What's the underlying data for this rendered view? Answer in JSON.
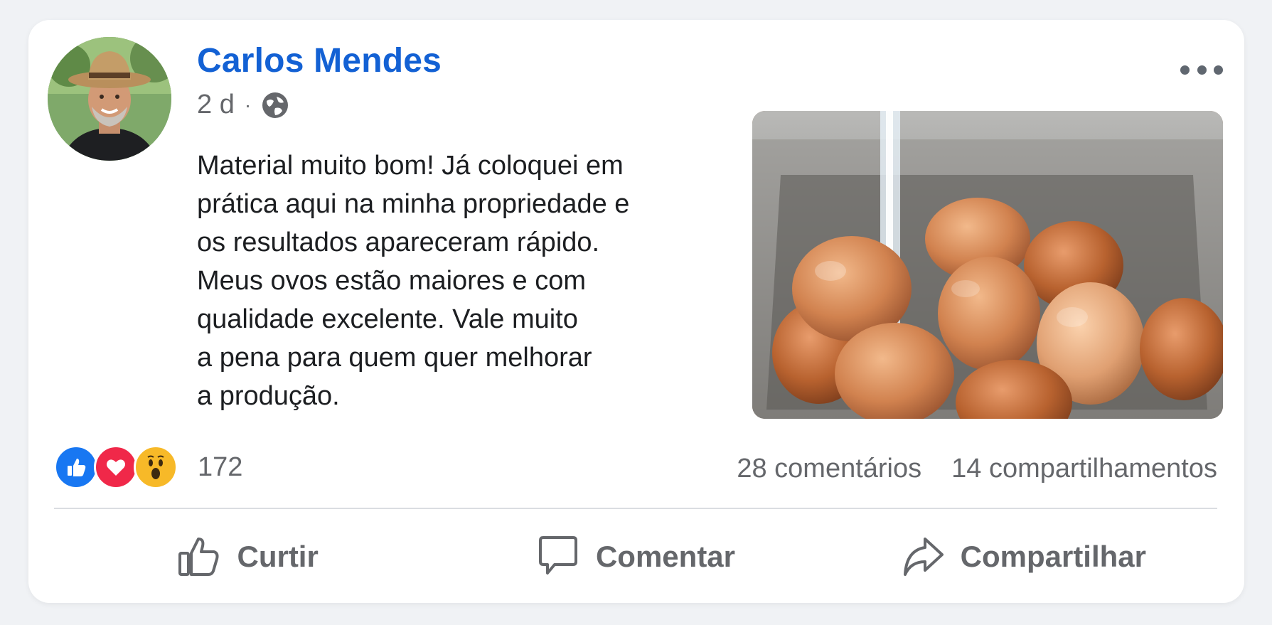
{
  "post": {
    "author": "Carlos Mendes",
    "time": "2 d",
    "separator": "·",
    "text": "Material muito bom! Já coloquei em\nprática aqui na minha propriedade e\nos resultados apareceram rápido.\nMeus ovos estão maiores e com\nqualidade excelente. Vale muito\na pena para quem quer melhorar\na produção.",
    "image_alt": "brown eggs in a stainless steel sink under running water"
  },
  "reactions": {
    "icons": [
      "like-icon",
      "love-icon",
      "wow-icon"
    ],
    "count": "172"
  },
  "stats": {
    "comments": "28 comentários",
    "shares": "14 compartilhamentos"
  },
  "actions": {
    "like_label": "Curtir",
    "comment_label": "Comentar",
    "share_label": "Compartilhar"
  },
  "colors": {
    "author": "#1361d4",
    "like": "#1877f2",
    "love": "#f02849",
    "wow": "#f7b928",
    "muted": "#65676b"
  }
}
